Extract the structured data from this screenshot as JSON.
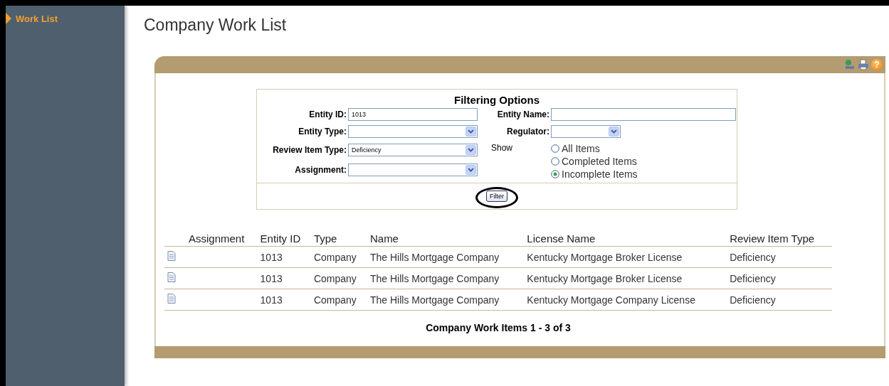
{
  "sidebar": {
    "items": [
      {
        "label": "Work List",
        "selected": true
      }
    ]
  },
  "page_title": "Company Work List",
  "help_glyph": "?",
  "filter": {
    "title": "Filtering Options",
    "left_fields": [
      {
        "kind": "text",
        "label": "Entity ID:",
        "value": "1013"
      },
      {
        "kind": "select",
        "label": "Entity Type:"
      },
      {
        "kind": "select",
        "label": "Review Item Type:",
        "value": "Deficiency"
      },
      {
        "kind": "select",
        "label": "Assignment:"
      }
    ],
    "right_fields": [
      {
        "kind": "text",
        "label": "Entity Name:"
      },
      {
        "kind": "select",
        "label": "Regulator:"
      }
    ],
    "show_label": "Show",
    "show_options": [
      {
        "label": "All Items",
        "selected": false
      },
      {
        "label": "Completed Items",
        "selected": false
      },
      {
        "label": "Incomplete Items",
        "selected": true
      }
    ],
    "button": "Filter"
  },
  "table": {
    "columns": [
      "Assignment",
      "Entity ID",
      "Type",
      "Name",
      "License Name",
      "Review Item Type"
    ],
    "rows": [
      {
        "cells": [
          "",
          "1013",
          "Company",
          "The Hills Mortgage Company",
          "Kentucky Mortgage Broker License",
          "Deficiency"
        ]
      },
      {
        "cells": [
          "",
          "1013",
          "Company",
          "The Hills Mortgage Company",
          "Kentucky Mortgage Broker License",
          "Deficiency"
        ]
      },
      {
        "cells": [
          "",
          "1013",
          "Company",
          "The Hills Mortgage Company",
          "Kentucky Mortgage Company License",
          "Deficiency"
        ]
      }
    ]
  },
  "footer": "Company Work Items 1 - 3 of 3"
}
